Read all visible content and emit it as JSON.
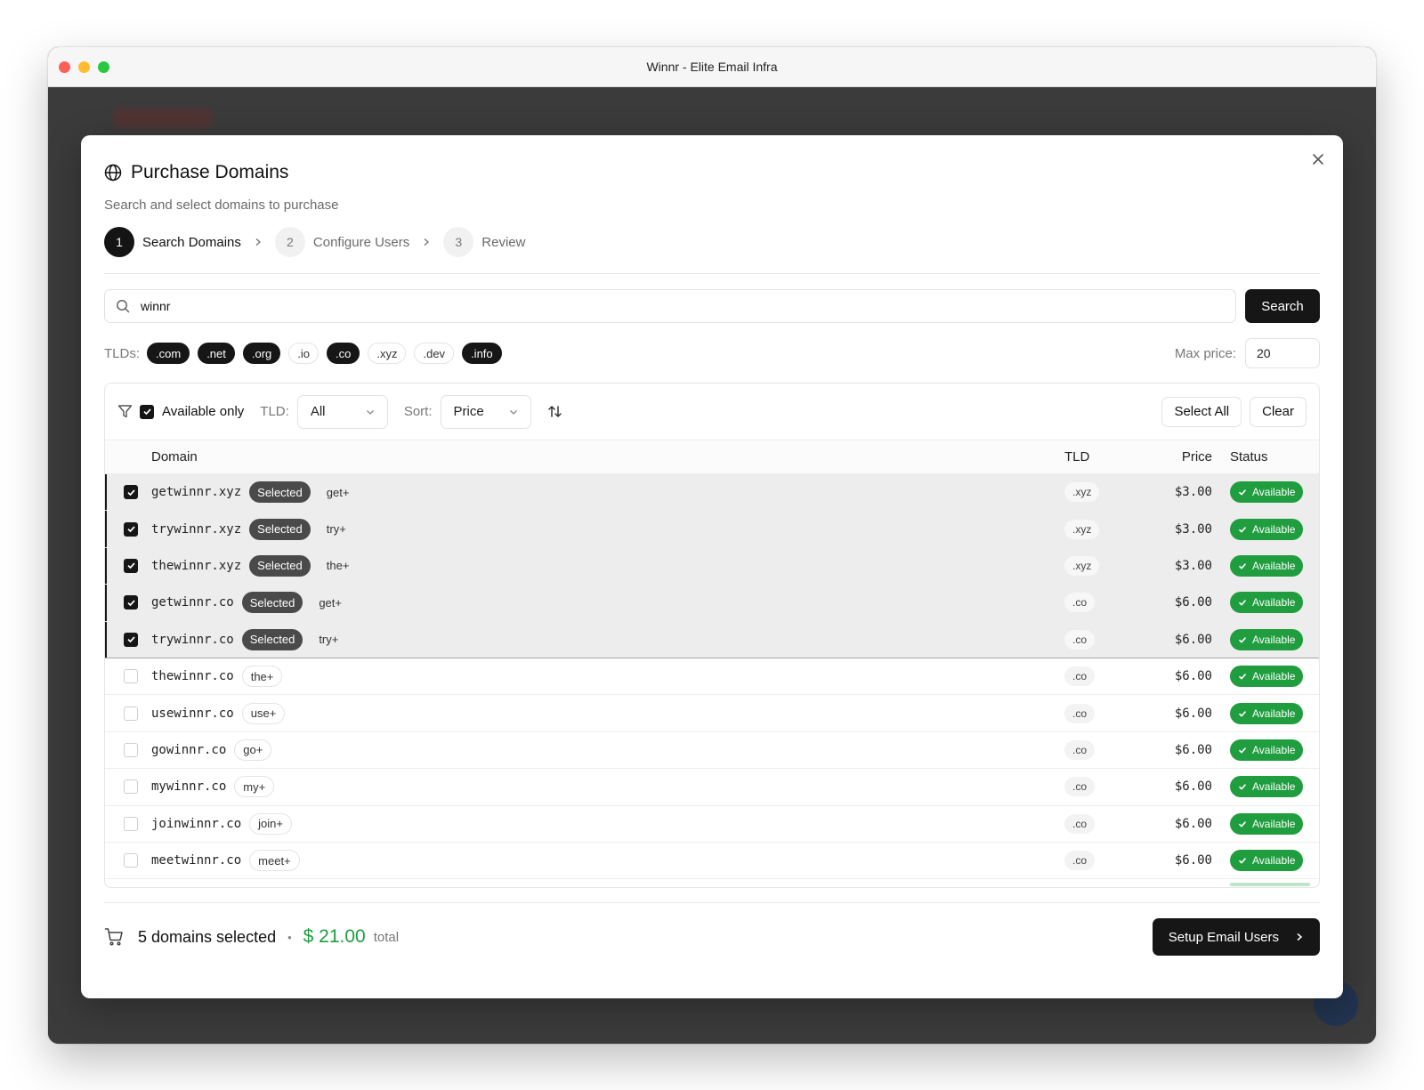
{
  "window": {
    "title": "Winnr - Elite Email Infra"
  },
  "modal": {
    "title": "Purchase Domains",
    "subtitle": "Search and select domains to purchase",
    "steps": [
      {
        "num": "1",
        "label": "Search Domains",
        "active": true
      },
      {
        "num": "2",
        "label": "Configure Users",
        "active": false
      },
      {
        "num": "3",
        "label": "Review",
        "active": false
      }
    ]
  },
  "search": {
    "value": "winnr",
    "button": "Search"
  },
  "tlds": {
    "label": "TLDs:",
    "chips": [
      {
        "label": ".com",
        "on": true
      },
      {
        "label": ".net",
        "on": true
      },
      {
        "label": ".org",
        "on": true
      },
      {
        "label": ".io",
        "on": false
      },
      {
        "label": ".co",
        "on": true
      },
      {
        "label": ".xyz",
        "on": false
      },
      {
        "label": ".dev",
        "on": false
      },
      {
        "label": ".info",
        "on": true
      }
    ],
    "max_price_label": "Max price:",
    "max_price_value": "20"
  },
  "filters": {
    "available_only_label": "Available only",
    "available_only_checked": true,
    "tld_label": "TLD:",
    "tld_value": "All",
    "sort_label": "Sort:",
    "sort_value": "Price",
    "select_all": "Select All",
    "clear": "Clear"
  },
  "table": {
    "headers": {
      "domain": "Domain",
      "tld": "TLD",
      "price": "Price",
      "status": "Status"
    },
    "selected_badge": "Selected",
    "rows": [
      {
        "domain": "getwinnr.xyz",
        "prefix": "get+",
        "tld": ".xyz",
        "price": "$3.00",
        "status": "Available",
        "selected": true
      },
      {
        "domain": "trywinnr.xyz",
        "prefix": "try+",
        "tld": ".xyz",
        "price": "$3.00",
        "status": "Available",
        "selected": true
      },
      {
        "domain": "thewinnr.xyz",
        "prefix": "the+",
        "tld": ".xyz",
        "price": "$3.00",
        "status": "Available",
        "selected": true
      },
      {
        "domain": "getwinnr.co",
        "prefix": "get+",
        "tld": ".co",
        "price": "$6.00",
        "status": "Available",
        "selected": true
      },
      {
        "domain": "trywinnr.co",
        "prefix": "try+",
        "tld": ".co",
        "price": "$6.00",
        "status": "Available",
        "selected": true
      },
      {
        "domain": "thewinnr.co",
        "prefix": "the+",
        "tld": ".co",
        "price": "$6.00",
        "status": "Available",
        "selected": false
      },
      {
        "domain": "usewinnr.co",
        "prefix": "use+",
        "tld": ".co",
        "price": "$6.00",
        "status": "Available",
        "selected": false
      },
      {
        "domain": "gowinnr.co",
        "prefix": "go+",
        "tld": ".co",
        "price": "$6.00",
        "status": "Available",
        "selected": false
      },
      {
        "domain": "mywinnr.co",
        "prefix": "my+",
        "tld": ".co",
        "price": "$6.00",
        "status": "Available",
        "selected": false
      },
      {
        "domain": "joinwinnr.co",
        "prefix": "join+",
        "tld": ".co",
        "price": "$6.00",
        "status": "Available",
        "selected": false
      },
      {
        "domain": "meetwinnr.co",
        "prefix": "meet+",
        "tld": ".co",
        "price": "$6.00",
        "status": "Available",
        "selected": false
      }
    ]
  },
  "footer": {
    "selected_count": "5 domains selected",
    "separator": "•",
    "total": "$ 21.00",
    "total_label": "total",
    "cta": "Setup Email Users"
  },
  "colors": {
    "accent": "#161616",
    "success": "#1f9d3f",
    "selected_row": "#ededed"
  },
  "icons": [
    "globe-icon",
    "close-icon",
    "chevron-right-icon",
    "search-icon",
    "filter-icon",
    "chevron-down-icon",
    "sort-icon",
    "check-icon",
    "cart-icon"
  ]
}
